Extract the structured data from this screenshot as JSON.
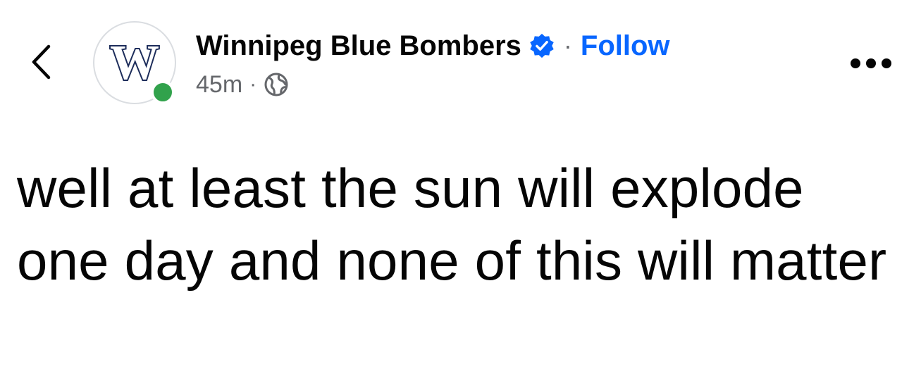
{
  "post": {
    "page_name": "Winnipeg Blue Bombers",
    "separator": "·",
    "follow_label": "Follow",
    "timestamp": "45m",
    "meta_separator": "·",
    "audience_icon": "globe-icon",
    "verified_icon": "verified-badge-icon",
    "avatar_logo_text": "W",
    "text": "well at least the sun will explode one day and none of this will matter"
  },
  "colors": {
    "follow": "#0866ff",
    "verified": "#0866ff",
    "online": "#31a24c",
    "secondary_text": "#65676b",
    "logo_navy": "#1c2c5a"
  },
  "icons": {
    "back": "chevron-left-icon",
    "more": "more-horizontal-icon"
  }
}
